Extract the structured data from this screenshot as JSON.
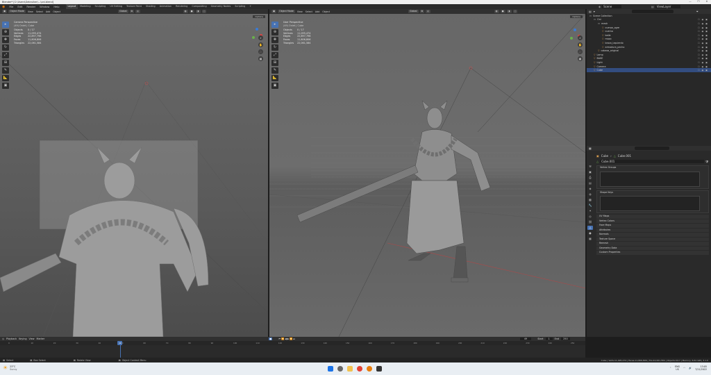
{
  "window": {
    "title": "Blender* [C:\\Users\\Gebruiker\\...\\oni.blend]",
    "controls": [
      "—",
      "☐",
      "✕"
    ]
  },
  "menu": [
    "File",
    "Edit",
    "Render",
    "Window",
    "Help"
  ],
  "workspaces": [
    "Layout",
    "Modeling",
    "Sculpting",
    "UV Editing",
    "Texture Paint",
    "Shading",
    "Animation",
    "Rendering",
    "Compositing",
    "Geometry Nodes",
    "Scripting"
  ],
  "active_workspace": "Layout",
  "scene": {
    "label": "Scene",
    "view_layer": "ViewLayer"
  },
  "viewport_left": {
    "mode": "Object Mode",
    "menus": [
      "View",
      "Select",
      "Add",
      "Object"
    ],
    "transform": "Global",
    "view_title": "Camera Perspective",
    "collection": "(49) Oniet | Cube",
    "stats": [
      {
        "label": "Objects",
        "value": "0 / 17"
      },
      {
        "label": "Vertices",
        "value": "11,095,474"
      },
      {
        "label": "Edges",
        "value": "22,897,798"
      },
      {
        "label": "Faces",
        "value": "11,806,806"
      },
      {
        "label": "Triangles",
        "value": "22,061,584"
      }
    ],
    "options_label": "Options"
  },
  "viewport_right": {
    "mode": "Object Mode",
    "menus": [
      "View",
      "Select",
      "Add",
      "Object"
    ],
    "transform": "Global",
    "view_title": "User Perspective",
    "collection": "(49) Oniet | Cube",
    "stats": [
      {
        "label": "Objects",
        "value": "0 / 17"
      },
      {
        "label": "Vertices",
        "value": "11,095,474"
      },
      {
        "label": "Edges",
        "value": "22,897,798"
      },
      {
        "label": "Faces",
        "value": "11,806,806"
      },
      {
        "label": "Triangles",
        "value": "22,061,584"
      }
    ],
    "options_label": "Options"
  },
  "outliner": {
    "search_placeholder": "",
    "items": [
      {
        "name": "Scene Collection",
        "indent": 0,
        "selected": false
      },
      {
        "name": "Oni",
        "indent": 1,
        "selected": false
      },
      {
        "name": "mesh",
        "indent": 2,
        "selected": false
      },
      {
        "name": "cuerpo_ogre",
        "indent": 3,
        "selected": false
      },
      {
        "name": "cuerno",
        "indent": 3,
        "selected": false
      },
      {
        "name": "baile",
        "indent": 3,
        "selected": false
      },
      {
        "name": "mazo",
        "indent": 3,
        "selected": false
      },
      {
        "name": "brazo_izquierdo",
        "indent": 3,
        "selected": false
      },
      {
        "name": "armadura_pecho",
        "indent": 3,
        "selected": false
      },
      {
        "name": "cabeza_original",
        "indent": 2,
        "selected": false
      },
      {
        "name": "Lamp",
        "indent": 1,
        "selected": false
      },
      {
        "name": "BAKE",
        "indent": 1,
        "selected": false
      },
      {
        "name": "Light",
        "indent": 1,
        "selected": false
      },
      {
        "name": "Camera",
        "indent": 1,
        "selected": false
      },
      {
        "name": "Cube",
        "indent": 1,
        "selected": true
      }
    ]
  },
  "properties": {
    "object": "Cube",
    "data": "Cube.001",
    "mesh_name": "Cube.001",
    "panels": [
      {
        "name": "Vertex Groups",
        "type": "list"
      },
      {
        "name": "Shape Keys",
        "type": "list"
      },
      {
        "name": "UV Maps",
        "type": "header"
      },
      {
        "name": "Vertex Colors",
        "type": "header"
      },
      {
        "name": "Face Maps",
        "type": "header"
      },
      {
        "name": "Attributes",
        "type": "header"
      },
      {
        "name": "Normals",
        "type": "header"
      },
      {
        "name": "Texture Space",
        "type": "header"
      },
      {
        "name": "Remesh",
        "type": "header"
      },
      {
        "name": "Geometry Data",
        "type": "header"
      },
      {
        "name": "Custom Properties",
        "type": "header"
      }
    ],
    "tab_icons": [
      "tool-icon",
      "render-icon",
      "output-icon",
      "view-layer-icon",
      "scene-icon",
      "world-icon",
      "object-icon",
      "modifier-icon",
      "particles-icon",
      "physics-icon",
      "constraints-icon",
      "data-icon",
      "material-icon",
      "texture-icon"
    ]
  },
  "timeline": {
    "menus": [
      "Playback",
      "Keying",
      "View",
      "Marker"
    ],
    "current_frame": "49",
    "start_label": "Start",
    "start": "1",
    "end_label": "End",
    "end": "250",
    "ticks": [
      "0",
      "10",
      "20",
      "30",
      "40",
      "50",
      "60",
      "70",
      "80",
      "90",
      "100",
      "110",
      "120",
      "130",
      "140",
      "150",
      "160",
      "170",
      "180",
      "190",
      "200",
      "210",
      "220",
      "230",
      "240",
      "250"
    ]
  },
  "statusbar": {
    "left": [
      "Select",
      "Box Select",
      "Rotate View",
      "Object Context Menu"
    ],
    "right": "Cube | Verts:11,095,474 | Faces:11,806,806 | Tris:22,061,584 | Objects:0/17 | Memory: 6.61 GiB | 3.1.0"
  },
  "taskbar": {
    "weather": "23°C",
    "weather_sub": "Sunny",
    "lang": "ENG",
    "region": "US",
    "time": "13:05",
    "date": "7/11/2022"
  },
  "colors": {
    "accent": "#4772b3",
    "selection": "#334d80",
    "panel": "#2a2a2a"
  }
}
